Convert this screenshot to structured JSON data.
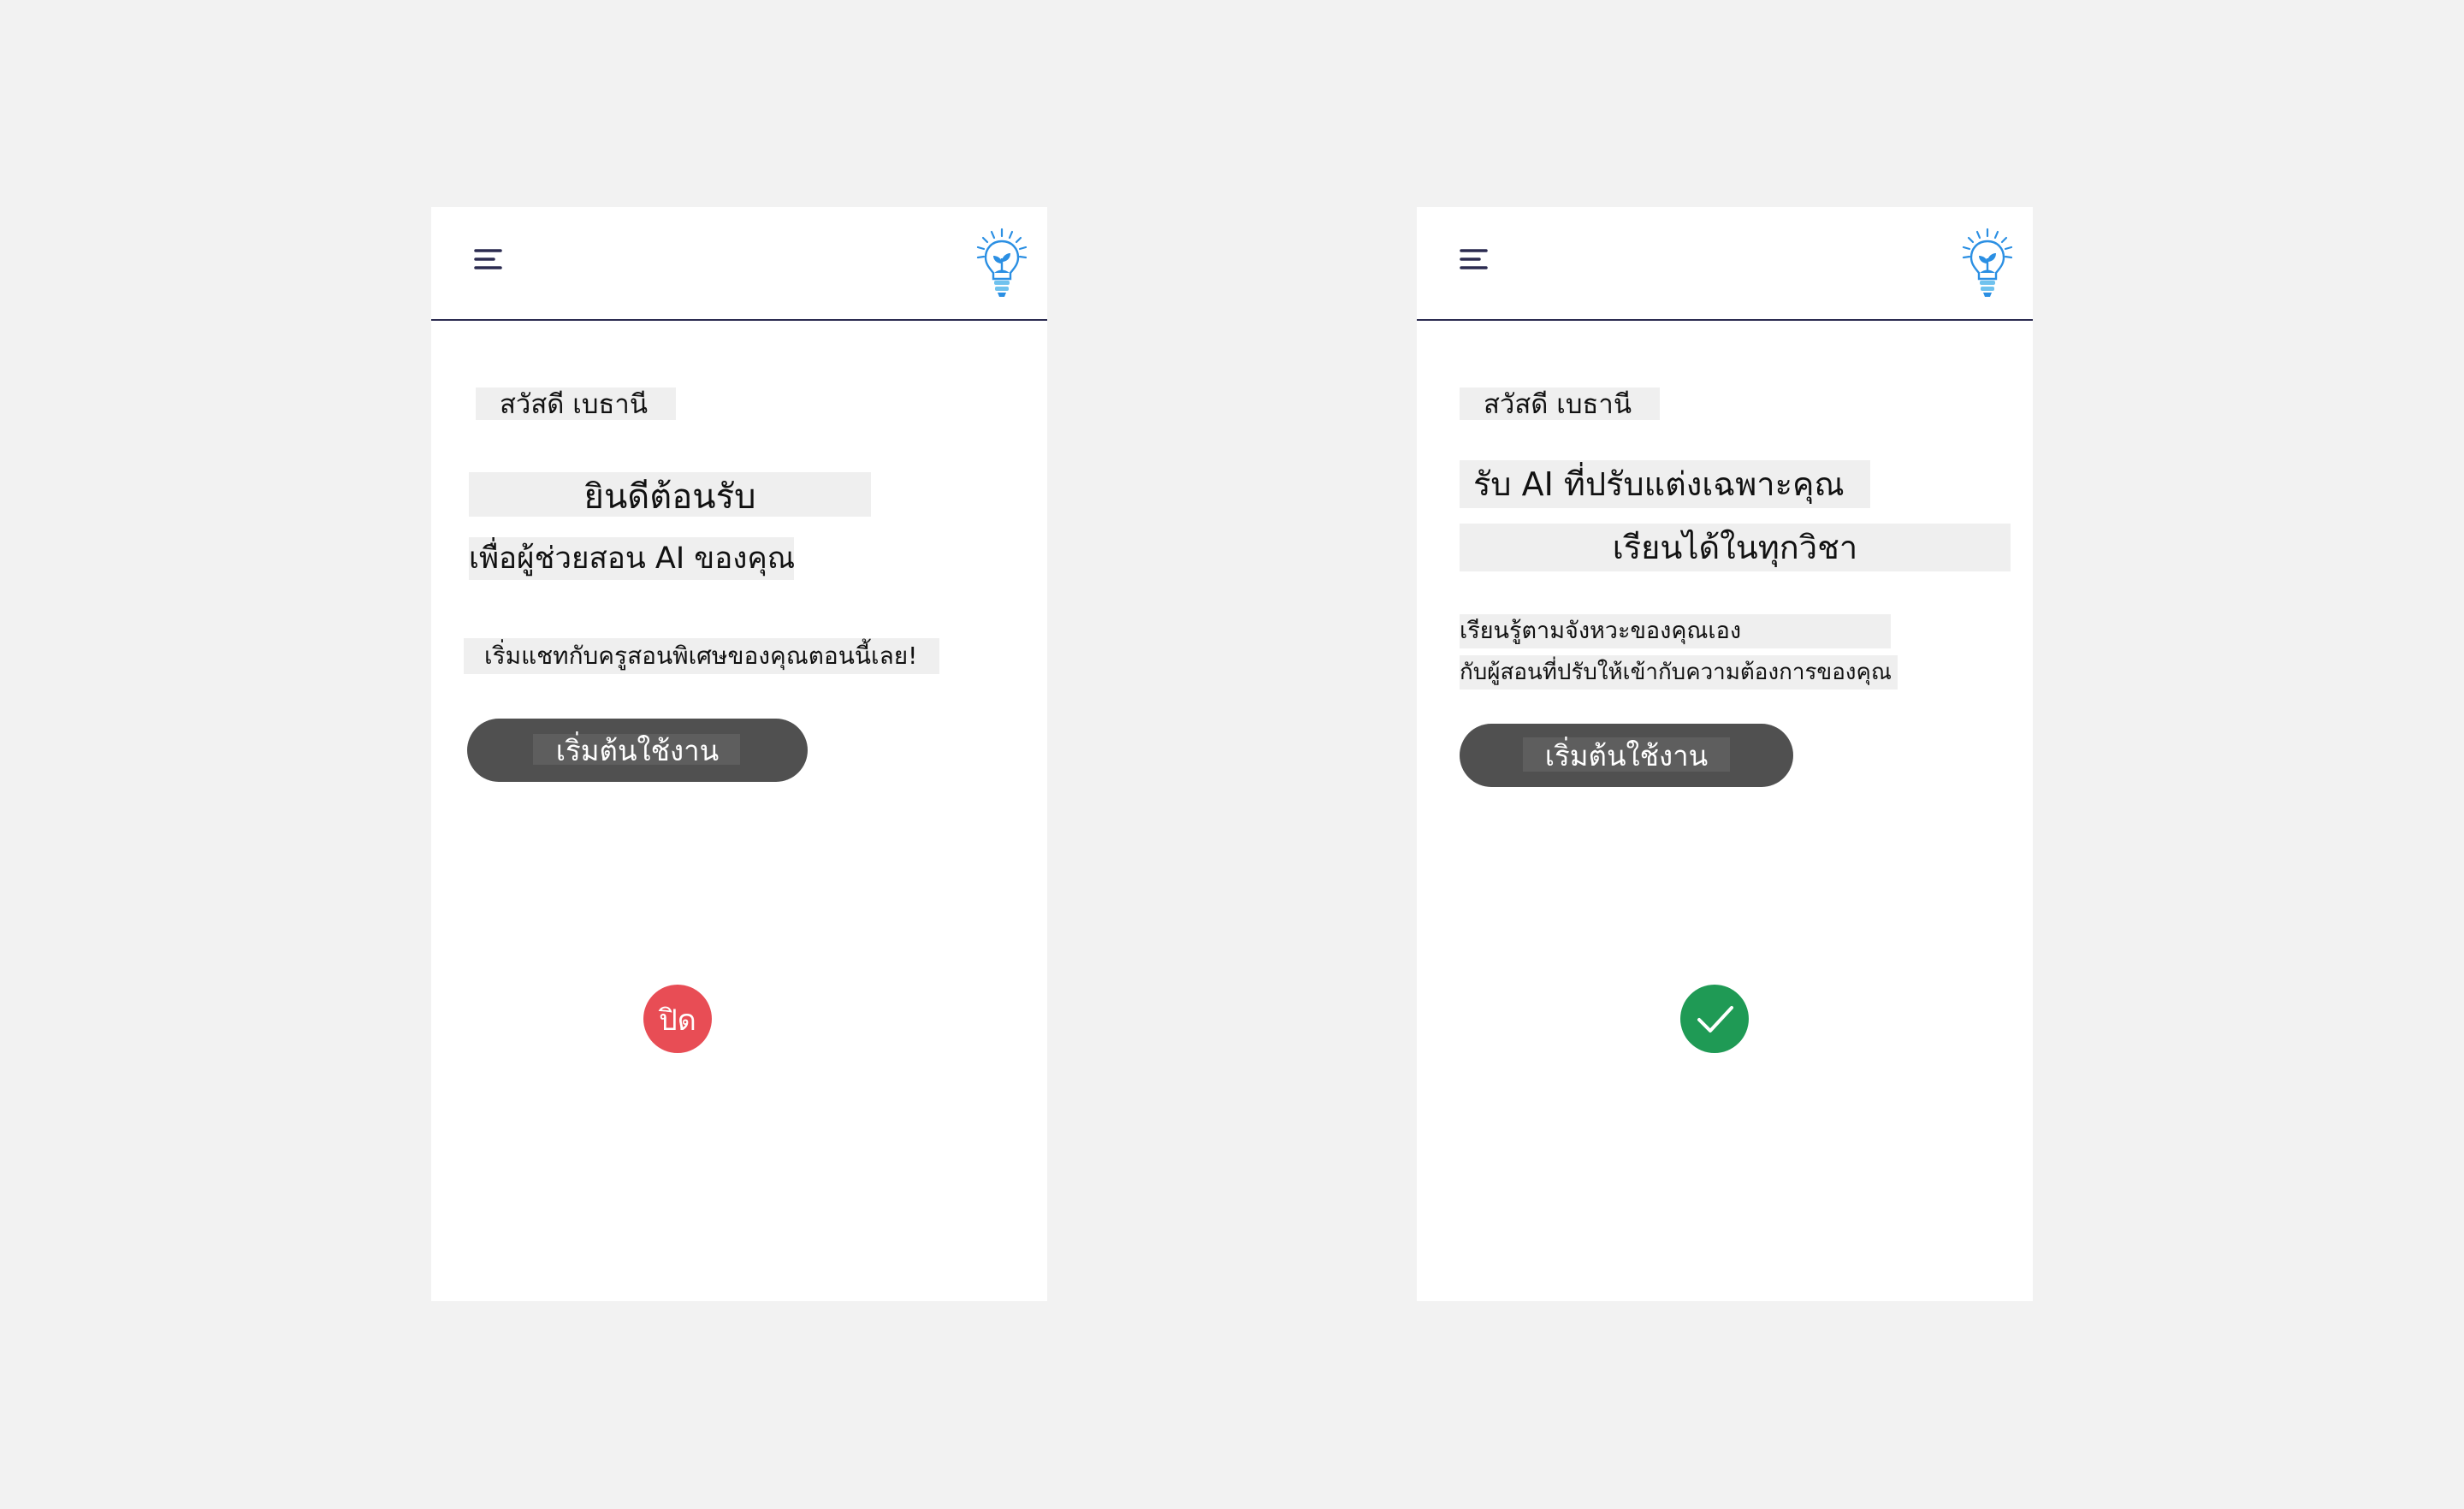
{
  "left_screen": {
    "greeting": "สวัสดี เบธานี",
    "headline": "ยินดีต้อนรับ",
    "subheadline": "เพื่อผู้ช่วยสอน AI ของคุณ",
    "body": "เริ่มแชทกับครูสอนพิเศษของคุณตอนนี้เลย!",
    "cta_label": "เริ่มต้นใช้งาน",
    "status_label": "ปิด",
    "status_color": "#e84d55"
  },
  "right_screen": {
    "greeting": "สวัสดี เบธานี",
    "headline_line1": "รับ AI ที่ปรับแต่งเฉพาะคุณ",
    "headline_line2": "เรียนได้ในทุกวิชา",
    "body_line1": "เรียนรู้ตามจังหวะของคุณเอง",
    "body_line2": "กับผู้สอนที่ปรับให้เข้ากับความต้องการของคุณ",
    "cta_label": "เริ่มต้นใช้งาน",
    "status_icon": "check-icon",
    "status_color": "#1f9a55"
  },
  "icons": {
    "menu": "menu-icon",
    "logo": "lightbulb-plant-logo"
  },
  "colors": {
    "background": "#f2f2f2",
    "screen": "#ffffff",
    "divider": "#2b2b50",
    "button": "#505050",
    "logo_blue": "#2b8fe3",
    "logo_light_blue": "#6fc2ee"
  }
}
